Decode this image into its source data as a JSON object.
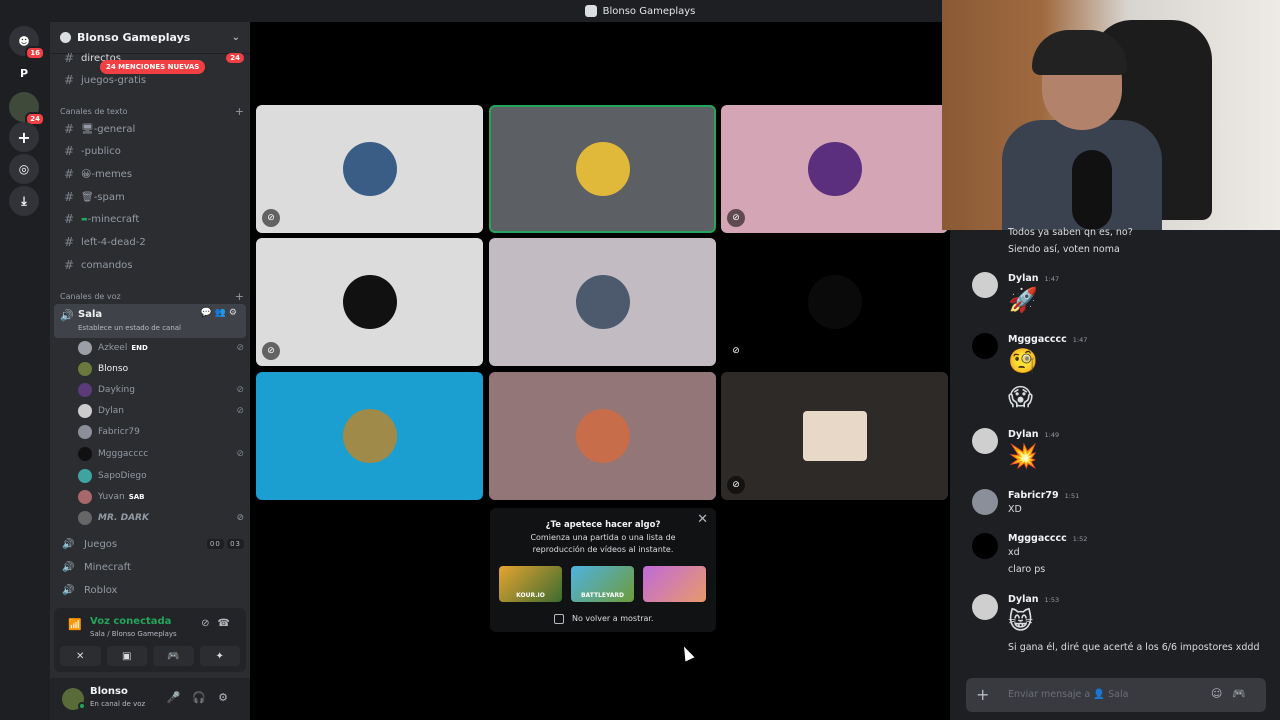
{
  "window": {
    "title": "Blonso Gameplays"
  },
  "rail": {
    "dm_badge": "16",
    "server_letter": "P",
    "server_badge": "24"
  },
  "server": {
    "name": "Blonso Gameplays",
    "mentions_pill": "24 MENCIONES NUEVAS",
    "top_channel": "directos",
    "top_channel_count": "24",
    "channels_top": [
      "juegos-gratis"
    ],
    "text_category": "Canales de texto",
    "text_channels": [
      "-general",
      "-publico",
      "-memes",
      "-spam",
      "-minecraft",
      "left-4-dead-2",
      "comandos"
    ],
    "text_channel_emoji": [
      "🖥",
      "",
      "😀",
      "🗑",
      "▬",
      "",
      ""
    ],
    "voice_category": "Canales de voz",
    "active_voice": {
      "name": "Sala",
      "status": "Establece un estado de canal"
    },
    "voice_users": [
      {
        "name": "Azkeel",
        "tag": "END",
        "muted": true,
        "color": "#9aa0a6"
      },
      {
        "name": "Blonso",
        "tag": "",
        "muted": false,
        "color": "#6b7a3c"
      },
      {
        "name": "Dayking",
        "tag": "",
        "muted": true,
        "color": "#5b3b7a"
      },
      {
        "name": "Dylan",
        "tag": "",
        "muted": true,
        "color": "#cccccc"
      },
      {
        "name": "Fabricr79",
        "tag": "",
        "muted": false,
        "color": "#8a8f99"
      },
      {
        "name": "Mgggacccc",
        "tag": "",
        "muted": true,
        "color": "#111111"
      },
      {
        "name": "SapoDiego",
        "tag": "",
        "muted": false,
        "color": "#3fa3a0"
      },
      {
        "name": "Yuvan",
        "tag": "SAB",
        "muted": false,
        "color": "#a8676b"
      },
      {
        "name": "MR. DARK",
        "tag": "",
        "muted": true,
        "color": "#666666"
      }
    ],
    "other_voice": [
      {
        "name": "Juegos",
        "counts": [
          "00",
          "03"
        ]
      },
      {
        "name": "Minecraft",
        "counts": []
      },
      {
        "name": "Roblox",
        "counts": []
      }
    ]
  },
  "voice_panel": {
    "status": "Voz conectada",
    "path": "Sala / Blonso Gameplays"
  },
  "user": {
    "name": "Blonso",
    "status": "En canal de voz"
  },
  "tiles": [
    {
      "bg": "#dcdcdc",
      "avatar": "#3a5d86",
      "muted": true,
      "speaking": false
    },
    {
      "bg": "#5c5f63",
      "avatar": "#e0b93a",
      "muted": false,
      "speaking": true
    },
    {
      "bg": "#d4a5b4",
      "avatar": "#5b2f7d",
      "muted": true,
      "speaking": false
    },
    {
      "bg": "#dcdcdc",
      "avatar": "#111111",
      "muted": true,
      "speaking": false
    },
    {
      "bg": "#c2bcc2",
      "avatar": "#4d5a6e",
      "muted": false,
      "speaking": false
    },
    {
      "bg": "#000000",
      "avatar": "#0a0a0a",
      "muted": true,
      "speaking": false
    },
    {
      "bg": "#1a9fd0",
      "avatar": "#a08a4a",
      "muted": false,
      "speaking": false
    },
    {
      "bg": "#937778",
      "avatar": "#c76d4a",
      "muted": false,
      "speaking": false
    },
    {
      "bg": "#2e2a28",
      "avatar": "#e8d8c8",
      "muted": true,
      "speaking": false
    }
  ],
  "popup": {
    "question": "¿Te apetece hacer algo?",
    "subtitle": "Comienza una partida o una lista de reproducción de vídeos al instante.",
    "games": [
      "KOUR.IO",
      "BATTLEYARD",
      ""
    ],
    "checkbox_label": "No volver a mostrar."
  },
  "chat": {
    "top_lines": [
      "Todos ya saben qn es, no?",
      "Siendo así, voten noma"
    ],
    "messages": [
      {
        "user": "Dylan",
        "time": "1:47",
        "content": "🚀"
      },
      {
        "user": "Mgggacccc",
        "time": "1:47",
        "content": "🧐"
      },
      {
        "user": "",
        "time": "",
        "content": "😱"
      },
      {
        "user": "Dylan",
        "time": "1:49",
        "content": "💥"
      },
      {
        "user": "Fabricr79",
        "time": "1:51",
        "content": "XD"
      },
      {
        "user": "Mgggacccc",
        "time": "1:52",
        "content": "xd"
      },
      {
        "user": "",
        "time": "",
        "content": "claro ps"
      },
      {
        "user": "Dylan",
        "time": "1:53",
        "content": "😸"
      },
      {
        "user": "",
        "time": "",
        "content": "Si gana él, diré que acerté a los 6/6 impostores xddd"
      }
    ],
    "input_placeholder": "Enviar mensaje a 👤 Sala"
  }
}
